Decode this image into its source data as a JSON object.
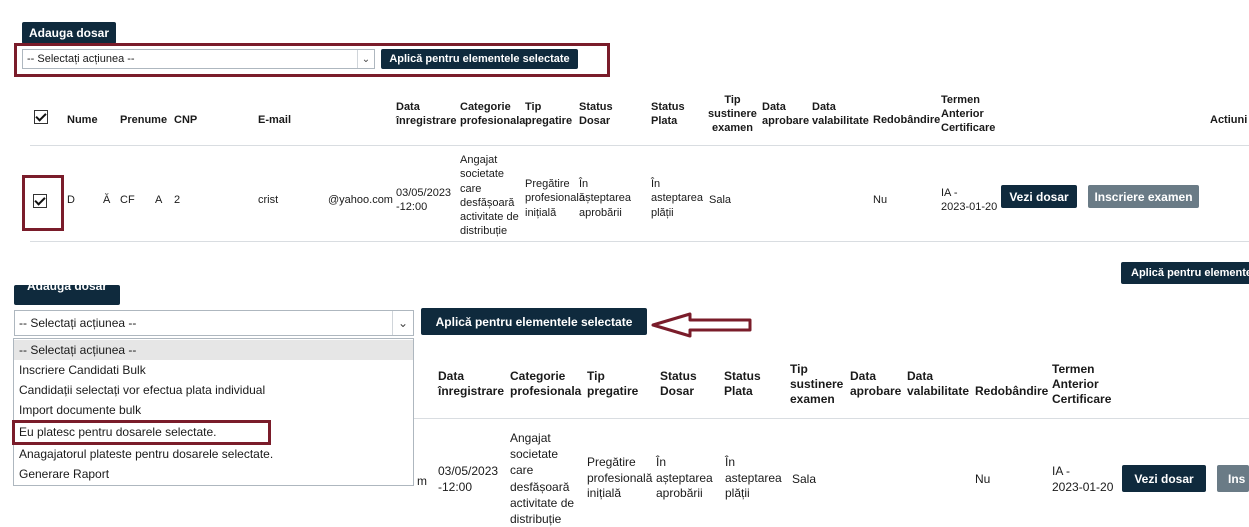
{
  "top": {
    "add_button": "Adauga dosar",
    "select_value": "-- Selectați acțiunea --",
    "apply_button": "Aplică pentru elementele selectate",
    "headers": {
      "nume": "Nume",
      "prenume": "Prenume",
      "cnp": "CNP",
      "email": "E-mail",
      "data1": "Data",
      "data2": "înregistrare",
      "cat1": "Categorie",
      "cat2": "profesionala",
      "tip1": "Tip",
      "tip2": "pregatire",
      "sd1": "Status",
      "sd2": "Dosar",
      "sp1": "Status",
      "sp2": "Plata",
      "ts1": "Tip",
      "ts2": "sustinere",
      "ts3": "examen",
      "da1": "Data",
      "da2": "aprobare",
      "dv1": "Data",
      "dv2": "valabilitate",
      "red": "Redobândire",
      "ta1": "Termen",
      "ta2": "Anterior",
      "ta3": "Certificare",
      "act": "Actiuni"
    },
    "row": {
      "nume": "D",
      "nume2": "Ă",
      "prenume": "CF",
      "prenume2": "A",
      "cnp": "2",
      "email_a": "crist",
      "email_b": "@yahoo.com",
      "data1": "03/05/2023",
      "data2": "-12:00",
      "cat": [
        "Angajat",
        "societate",
        "care",
        "desfășoară",
        "activitate de",
        "distribuție"
      ],
      "tip": [
        "Pregătire",
        "profesională",
        "inițială"
      ],
      "sd": [
        "În",
        "așteptarea",
        "aprobării"
      ],
      "sp": [
        "În",
        "asteptarea",
        "plății"
      ],
      "ts": "Sala",
      "red": "Nu",
      "ta1": "IA -",
      "ta2": "2023-01-20",
      "view_button": "Vezi dosar",
      "exam_button": "Inscriere examen"
    },
    "apply_bottom": "Aplică pentru elemente"
  },
  "bottom": {
    "add_button": "Adauga dosar",
    "select_value": "-- Selectați acțiunea --",
    "apply_button": "Aplică pentru elementele selectate",
    "options": [
      "-- Selectați acțiunea --",
      "Inscriere Candidati Bulk",
      "Candidații selectați vor efectua plata individual",
      "Import documente bulk",
      "Eu platesc pentru dosarele selectate.",
      "Anagajatorul plateste pentru dosarele selectate.",
      "Generare Raport"
    ],
    "headers": {
      "data1": "Data",
      "data2": "înregistrare",
      "cat1": "Categorie",
      "cat2": "profesionala",
      "tip1": "Tip",
      "tip2": "pregatire",
      "sd1": "Status",
      "sd2": "Dosar",
      "sp1": "Status",
      "sp2": "Plata",
      "ts1": "Tip",
      "ts2": "sustinere",
      "ts3": "examen",
      "da1": "Data",
      "da2": "aprobare",
      "dv1": "Data",
      "dv2": "valabilitate",
      "red": "Redobândire",
      "ta1": "Termen",
      "ta2": "Anterior",
      "ta3": "Certificare"
    },
    "row": {
      "email_tail": "m",
      "data1": "03/05/2023",
      "data2": "-12:00",
      "cat": [
        "Angajat",
        "societate",
        "care",
        "desfășoară",
        "activitate de",
        "distribuție"
      ],
      "tip": [
        "Pregătire",
        "profesională",
        "inițială"
      ],
      "sd": [
        "În",
        "așteptarea",
        "aprobării"
      ],
      "sp": [
        "În",
        "asteptarea",
        "plății"
      ],
      "ts": "Sala",
      "red": "Nu",
      "ta1": "IA -",
      "ta2": "2023-01-20",
      "view_button": "Vezi dosar",
      "exam_button_partial": "Ins"
    }
  },
  "colors": {
    "button_dark": "#0f2a3d",
    "button_gray": "#6a7b86",
    "highlight": "#7a1c2a"
  }
}
